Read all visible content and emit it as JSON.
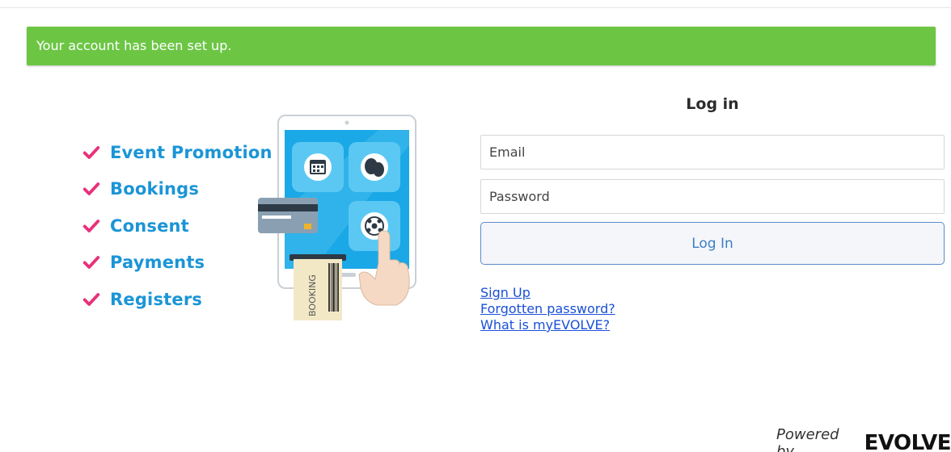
{
  "alert": {
    "message": "Your account has been set up.",
    "color": "#6cc644"
  },
  "features": [
    {
      "label": "Event Promotion",
      "icon": "check-icon"
    },
    {
      "label": "Bookings",
      "icon": "check-icon"
    },
    {
      "label": "Consent",
      "icon": "check-icon"
    },
    {
      "label": "Payments",
      "icon": "check-icon"
    },
    {
      "label": "Registers",
      "icon": "check-icon"
    }
  ],
  "illustration": {
    "ticket_text": "BOOKING"
  },
  "login": {
    "title": "Log in",
    "email_placeholder": "Email",
    "password_placeholder": "Password",
    "button_label": "Log In"
  },
  "links": {
    "sign_up": "Sign Up",
    "forgot_password": "Forgotten password?",
    "what_is": "What is myEVOLVE?"
  },
  "footer": {
    "powered_by": "Powered by",
    "brand": "EVOLVE"
  },
  "colors": {
    "accent_blue": "#1b95d6",
    "check_pink": "#e8317a",
    "link": "#1a4fd6",
    "button_border": "#5a8bc8"
  }
}
